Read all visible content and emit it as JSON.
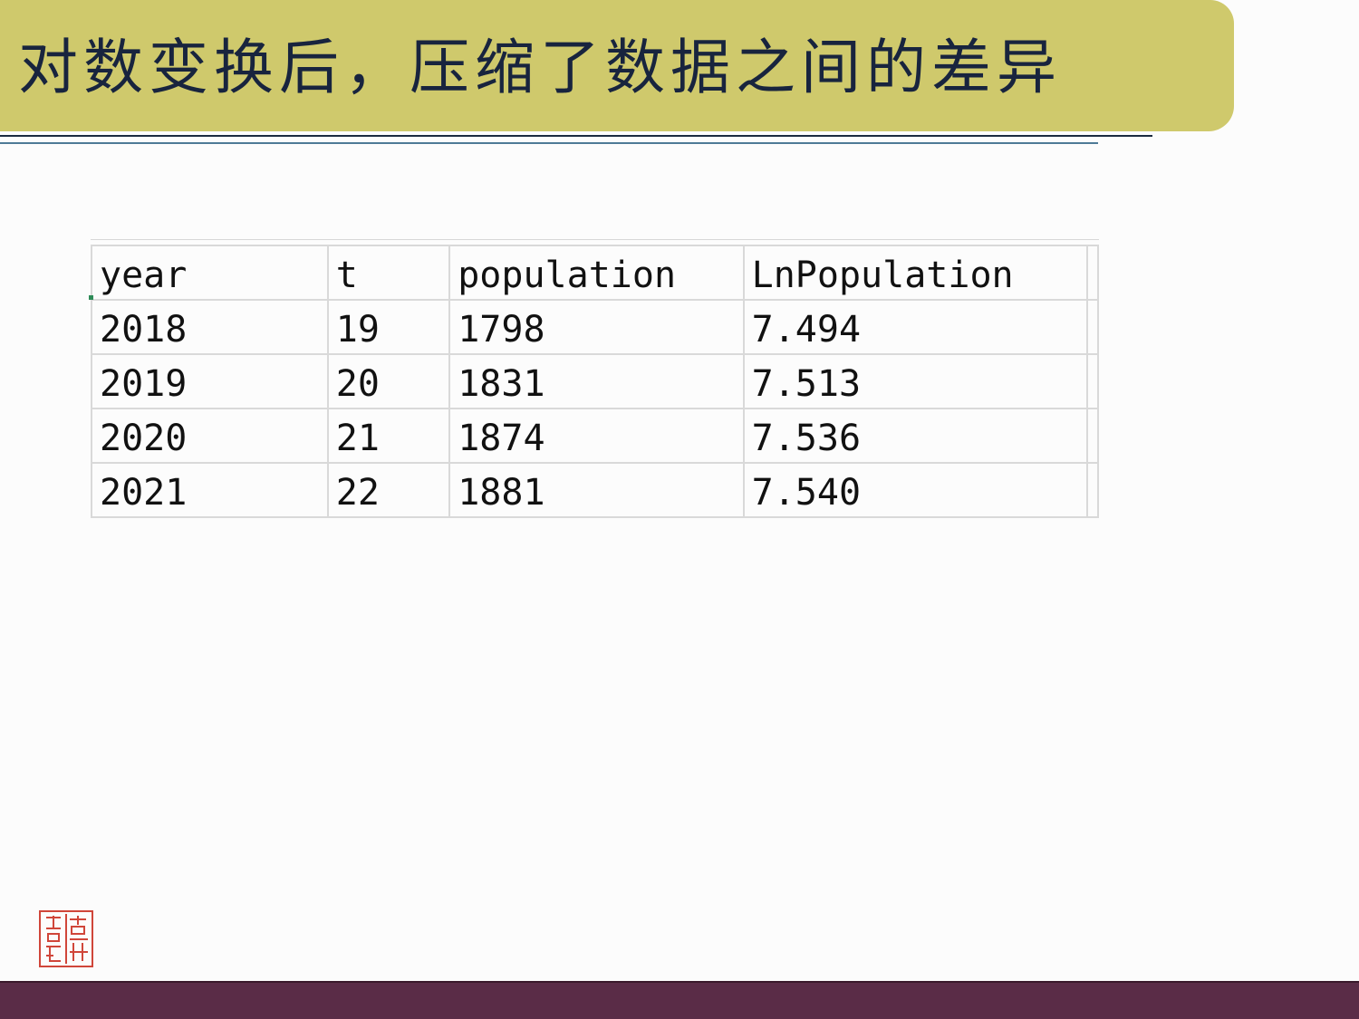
{
  "slide": {
    "title": "对数变换后，压缩了数据之间的差异"
  },
  "table": {
    "columns": [
      "year",
      "t",
      "population",
      "LnPopulation"
    ],
    "rows": [
      [
        "2018",
        "19",
        "1798",
        "7.494"
      ],
      [
        "2019",
        "20",
        "1831",
        "7.513"
      ],
      [
        "2020",
        "21",
        "1874",
        "7.536"
      ],
      [
        "2021",
        "22",
        "1881",
        "7.540"
      ]
    ]
  },
  "colors": {
    "title_bar": "#cfc96c",
    "title_text": "#18243e",
    "footer": "#5a2c47",
    "seal": "#d0463a"
  },
  "icons": [
    "seal-stamp-icon"
  ]
}
